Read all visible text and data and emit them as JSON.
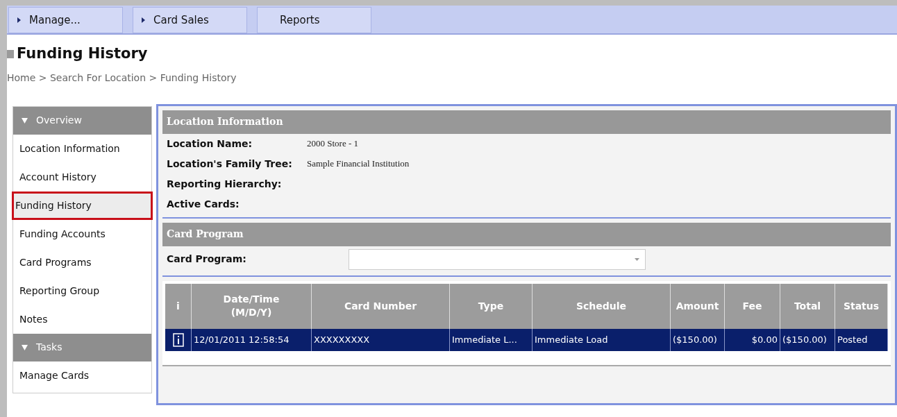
{
  "tabs": [
    {
      "label": "Manage...",
      "has_menu": true
    },
    {
      "label": "Card Sales",
      "has_menu": true
    },
    {
      "label": "Reports",
      "has_menu": false
    }
  ],
  "page_title": "Funding History",
  "breadcrumb": "Home > Search For Location > Funding History",
  "sidebar": {
    "sections": [
      {
        "title": "Overview",
        "expanded": true,
        "items": [
          {
            "label": "Location Information",
            "selected": false
          },
          {
            "label": "Account History",
            "selected": false
          },
          {
            "label": "Funding History",
            "selected": true
          },
          {
            "label": "Funding Accounts",
            "selected": false
          },
          {
            "label": "Card Programs",
            "selected": false
          },
          {
            "label": "Reporting Group",
            "selected": false
          },
          {
            "label": "Notes",
            "selected": false
          }
        ]
      },
      {
        "title": "Tasks",
        "expanded": true,
        "items": [
          {
            "label": "Manage Cards",
            "selected": false
          }
        ]
      }
    ]
  },
  "location_information": {
    "title": "Location Information",
    "fields": [
      {
        "label": "Location Name:",
        "value": "2000 Store - 1"
      },
      {
        "label": "Location's Family Tree:",
        "value": "Sample Financial Institution"
      },
      {
        "label": "Reporting Hierarchy:"
      },
      {
        "label": "Active Cards:"
      }
    ]
  },
  "card_program": {
    "title": "Card Program",
    "label": "Card Program:"
  },
  "table": {
    "columns": [
      "i",
      "Date/Time\n(M/D/Y)",
      "Card Number",
      "Type",
      "Schedule",
      "Amount",
      "Fee",
      "Total",
      "Status"
    ],
    "rows": [
      {
        "selected": true,
        "cells": [
          "",
          "12/01/2011 12:58:54",
          "XXXXXXXXX",
          "Immediate L...",
          "Immediate Load",
          "($150.00)",
          "$0.00",
          "($150.00)",
          "Posted"
        ]
      }
    ]
  }
}
